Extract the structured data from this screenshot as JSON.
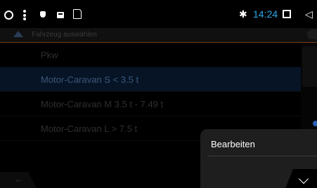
{
  "status_bar": {
    "time": "14:24",
    "icons": [
      "circle-icon",
      "kebab-icon",
      "shield-icon",
      "card-icon",
      "sd-card-icon",
      "bluetooth-icon",
      "square-icon",
      "back-triangle-icon"
    ],
    "time_color": "#2fa7e8"
  },
  "header": {
    "title": "Fahrzeug auswählen"
  },
  "vehicle_list": {
    "items": [
      {
        "label": "Pkw"
      },
      {
        "label": "Motor-Caravan S < 3.5 t"
      },
      {
        "label": "Motor-Caravan M 3.5 t - 7.49 t"
      },
      {
        "label": "Motor-Caravan L > 7.5 t"
      }
    ],
    "selected_index": 1
  },
  "popup": {
    "edit_label": "Bearbeiten"
  },
  "colors": {
    "accent_line": "#7a3f12",
    "selected_row": "#061426",
    "popup_bg": "#1e1e1e"
  }
}
